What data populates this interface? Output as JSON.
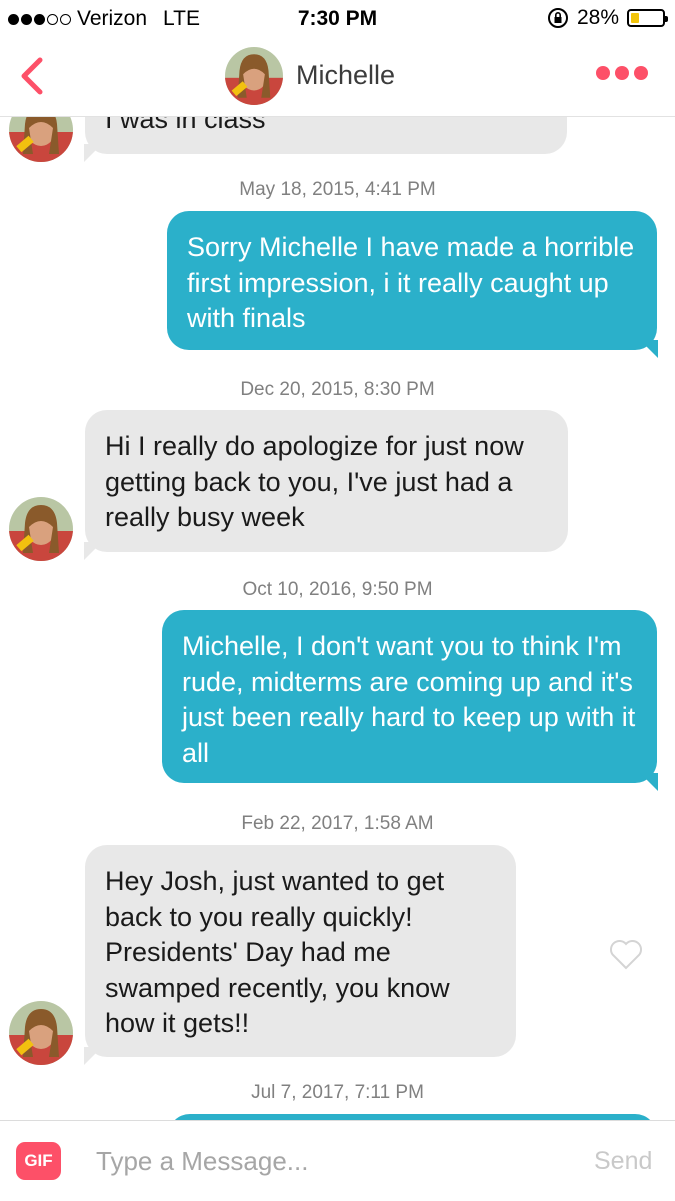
{
  "status_bar": {
    "carrier": "Verizon",
    "network": "LTE",
    "time": "7:30 PM",
    "battery": "28%",
    "battery_level": 0.28
  },
  "nav": {
    "title": "Michelle",
    "back_icon": "chevron-left-icon",
    "more_icon": "more-dots-icon"
  },
  "messages": [
    {
      "type": "incoming",
      "text": "I was in class"
    },
    {
      "type": "timestamp",
      "text": "May 18, 2015, 4:41 PM"
    },
    {
      "type": "outgoing",
      "text": "Sorry Michelle I have made a horrible first impression, i it really caught up with finals"
    },
    {
      "type": "timestamp",
      "text": "Dec 20, 2015, 8:30 PM"
    },
    {
      "type": "incoming",
      "text": "Hi I really do apologize for just now getting back to you, I've just had a really busy week"
    },
    {
      "type": "timestamp",
      "text": "Oct 10, 2016, 9:50 PM"
    },
    {
      "type": "outgoing",
      "text": "Michelle, I don't want you to think I'm rude, midterms are coming up and it's just been really hard to keep up with it all"
    },
    {
      "type": "timestamp",
      "text": "Feb 22, 2017, 1:58 AM"
    },
    {
      "type": "incoming",
      "text": "Hey Josh, just wanted to get back to you really quickly! Presidents' Day had me swamped recently, you know how it gets!!"
    },
    {
      "type": "timestamp",
      "text": "Jul 7, 2017, 7:11 PM"
    }
  ],
  "input_bar": {
    "gif_label": "GIF",
    "placeholder": "Type a Message...",
    "send_label": "Send"
  },
  "colors": {
    "accent": "#fd5068",
    "outgoing": "#2bb0ca",
    "incoming": "#e8e8e8"
  }
}
